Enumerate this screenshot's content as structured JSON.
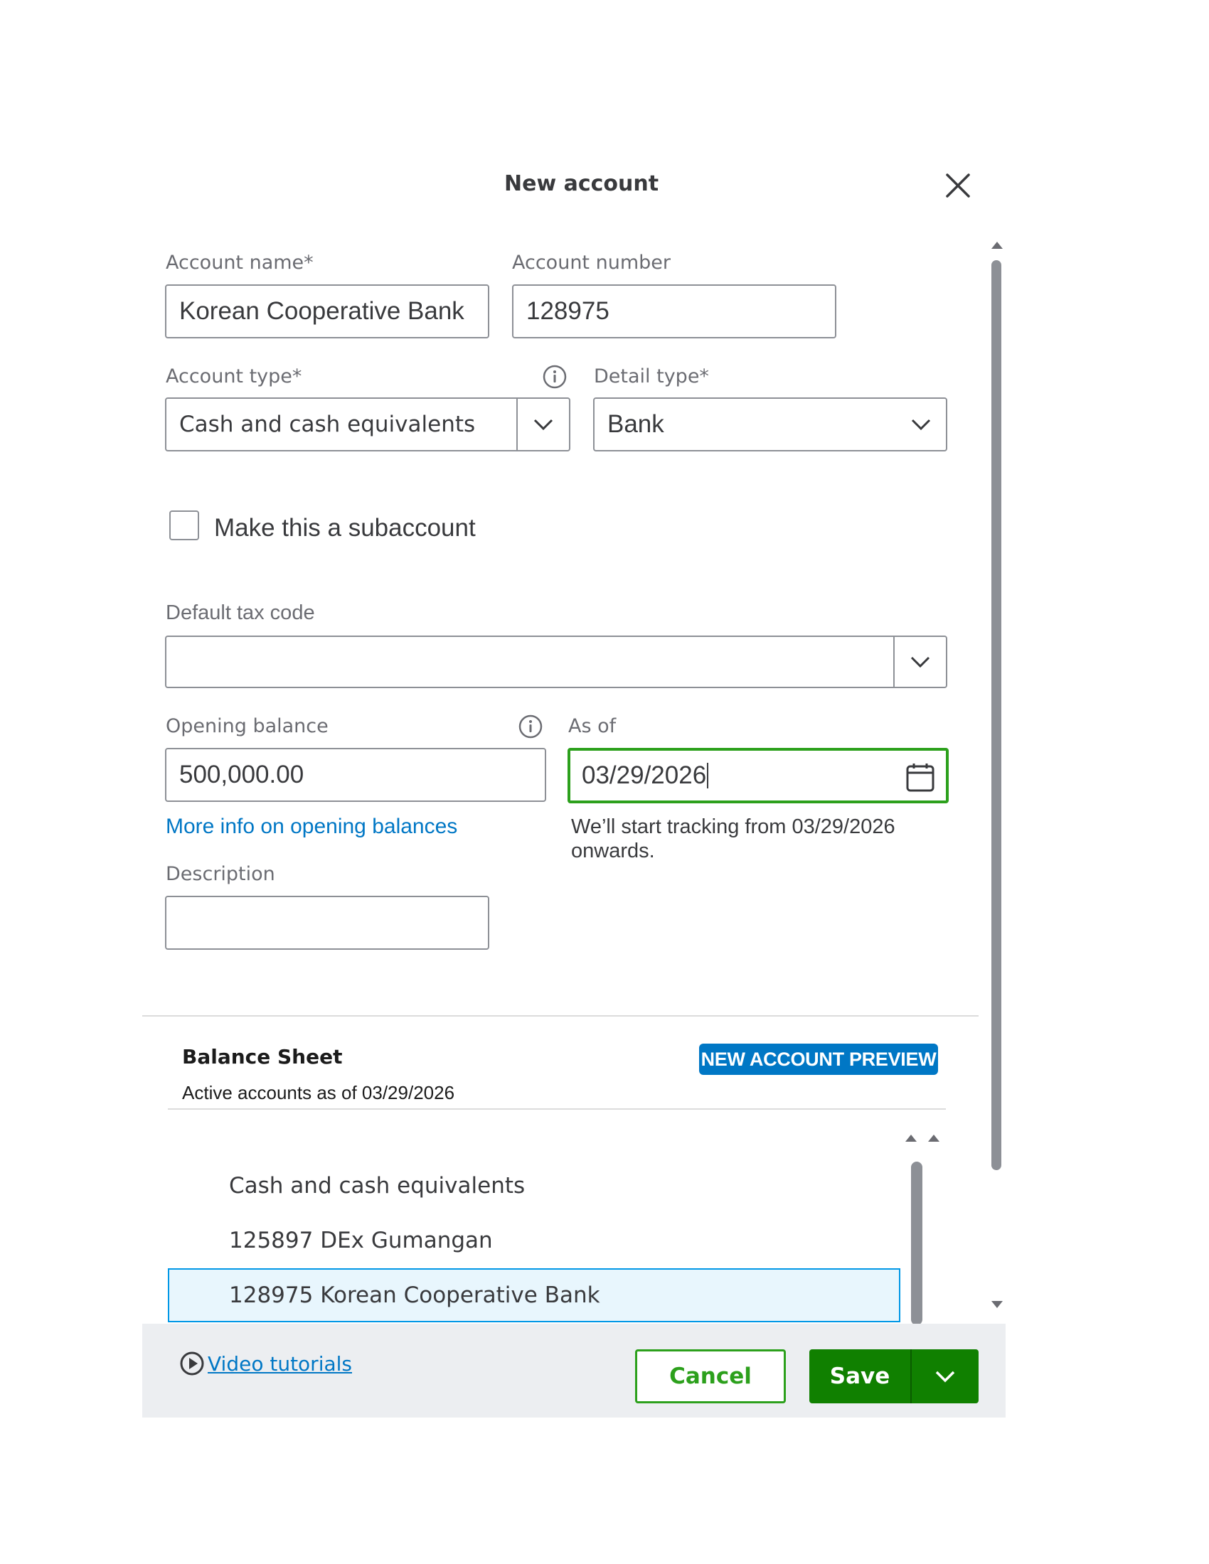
{
  "dialog": {
    "title": "New account"
  },
  "form": {
    "account_name": {
      "label": "Account name*",
      "value": "Korean Cooperative Bank"
    },
    "account_number": {
      "label": "Account number",
      "value": "128975"
    },
    "account_type": {
      "label": "Account type*",
      "value": "Cash and cash equivalents"
    },
    "detail_type": {
      "label": "Detail type*",
      "value": "Bank"
    },
    "subaccount": {
      "label": "Make this a subaccount",
      "checked": false
    },
    "default_tax_code": {
      "label": "Default tax code",
      "value": ""
    },
    "opening_balance": {
      "label": "Opening balance",
      "value": "500,000.00",
      "link": "More info on opening balances"
    },
    "as_of": {
      "label": "As of",
      "value": "03/29/2026",
      "hint": "We’ll start tracking from 03/29/2026 onwards."
    },
    "description": {
      "label": "Description",
      "value": ""
    }
  },
  "preview": {
    "title": "Balance Sheet",
    "subtitle": "Active accounts as of 03/29/2026",
    "badge": "NEW ACCOUNT PREVIEW",
    "items": [
      {
        "label": "Cash and cash equivalents",
        "highlight": false
      },
      {
        "label": "125897 DEx Gumangan",
        "highlight": false
      },
      {
        "label": "128975 Korean Cooperative Bank",
        "highlight": true
      }
    ]
  },
  "footer": {
    "video_tutorials": "Video tutorials",
    "cancel": "Cancel",
    "save": "Save"
  },
  "colors": {
    "primary_green": "#108000",
    "accent_green": "#2ca01c",
    "link_blue": "#0077c5",
    "badge_blue": "#0077c5",
    "highlight_bg": "#e8f6fd"
  },
  "icons": {
    "close": "close-icon",
    "info": "info-icon",
    "dropdown": "chevron-down-icon",
    "calendar": "calendar-icon",
    "play": "play-circle-icon"
  }
}
